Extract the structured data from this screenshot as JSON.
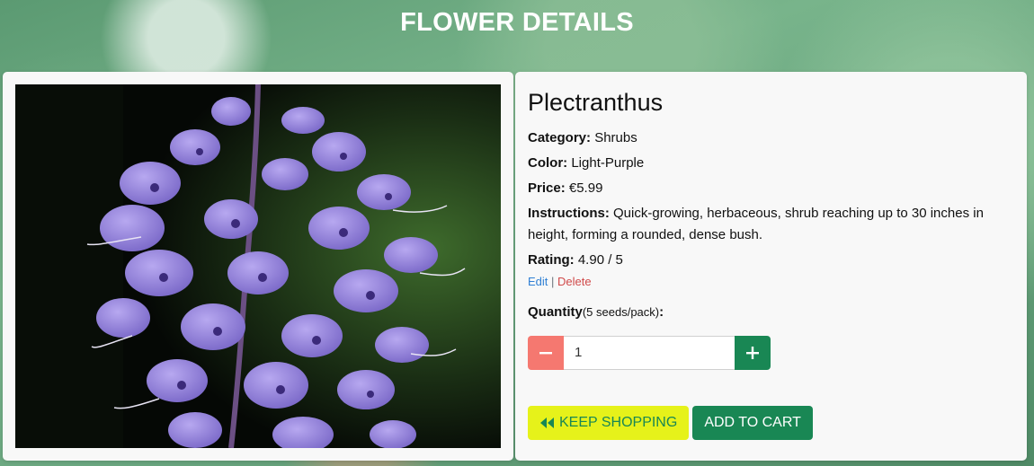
{
  "page": {
    "title": "FLOWER DETAILS"
  },
  "flower": {
    "name": "Plectranthus",
    "category_label": "Category:",
    "category": "Shrubs",
    "color_label": "Color:",
    "color": "Light-Purple",
    "price_label": "Price:",
    "price": "€5.99",
    "instructions_label": "Instructions:",
    "instructions": "Quick-growing, herbaceous, shrub reaching up to 30 inches in height, forming a rounded, dense bush.",
    "rating_label": "Rating:",
    "rating": "4.90 / 5"
  },
  "actions_links": {
    "edit": "Edit",
    "separator": "|",
    "delete": "Delete"
  },
  "quantity": {
    "label": "Quantity",
    "note": "(5 seeds/pack)",
    "colon": ":",
    "value": "1",
    "minus_icon": "minus-icon",
    "plus_icon": "plus-icon"
  },
  "buttons": {
    "keep_shopping": "KEEP SHOPPING",
    "keep_shopping_icon": "backward-icon",
    "add_to_cart": "ADD TO CART"
  },
  "colors": {
    "primary_green": "#198754",
    "danger_soft": "#f57870",
    "keep_shopping_bg": "#e6f21a",
    "edit_link": "#2f7fd4",
    "delete_link": "#d04a4a"
  }
}
